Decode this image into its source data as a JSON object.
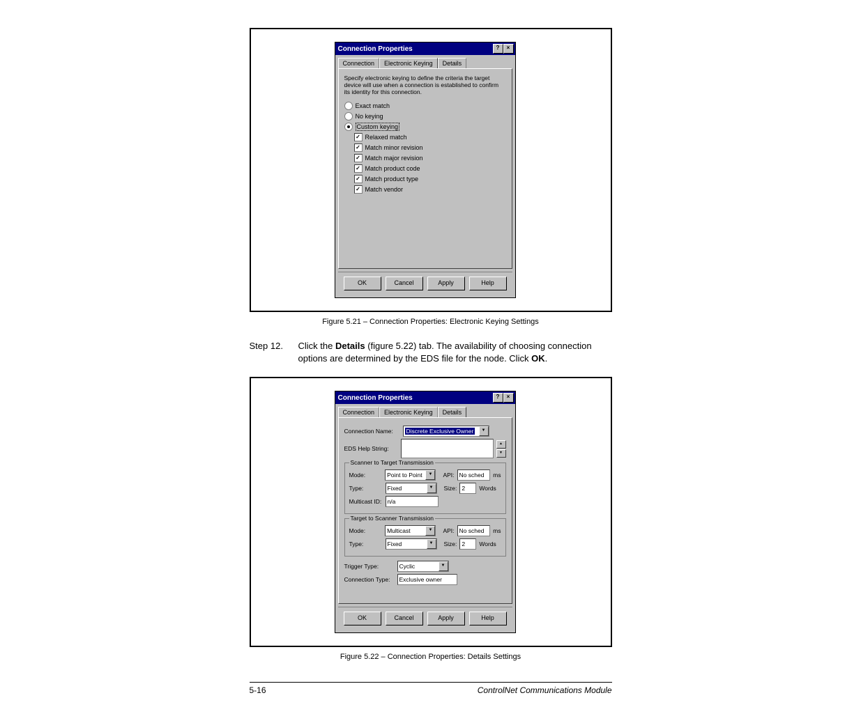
{
  "dialog1": {
    "title": "Connection Properties",
    "tabs": {
      "connection": "Connection",
      "ekeying": "Electronic Keying",
      "details": "Details"
    },
    "instruct": "Specify electronic keying to define the criteria the target device will use when a connection is established to confirm its identity for this connection.",
    "radios": {
      "exact": "Exact match",
      "none": "No keying",
      "custom": "Custom keying"
    },
    "checks": {
      "relaxed": "Relaxed match",
      "minor": "Match minor revision",
      "major": "Match major revision",
      "pcode": "Match product code",
      "ptype": "Match product type",
      "vendor": "Match vendor"
    },
    "buttons": {
      "ok": "OK",
      "cancel": "Cancel",
      "apply": "Apply",
      "help": "Help"
    }
  },
  "caption1": "Figure 5.21 – Connection Properties: Electronic Keying Settings",
  "step": {
    "label": "Step 12.",
    "text_a": "Click the ",
    "bold_a": "Details",
    "text_b": " (figure 5.22) tab. The availability of choosing connection options are determined by the EDS file for the node. Click ",
    "bold_b": "OK",
    "text_c": "."
  },
  "dialog2": {
    "title": "Connection Properties",
    "tabs": {
      "connection": "Connection",
      "ekeying": "Electronic Keying",
      "details": "Details"
    },
    "conn_name_lbl": "Connection Name:",
    "conn_name_val": "Discrete Exclusive Owner",
    "eds_help_lbl": "EDS Help String:",
    "group1": {
      "legend": "Scanner to Target Transmission",
      "mode_lbl": "Mode:",
      "mode_val": "Point to Point",
      "api_lbl": "API:",
      "api_val": "No sched",
      "api_unit": "ms",
      "type_lbl": "Type:",
      "type_val": "Fixed",
      "size_lbl": "Size:",
      "size_val": "2",
      "size_unit": "Words",
      "mcast_lbl": "Multicast ID:",
      "mcast_val": "n/a"
    },
    "group2": {
      "legend": "Target to Scanner Transmission",
      "mode_lbl": "Mode:",
      "mode_val": "Multicast",
      "api_lbl": "API:",
      "api_val": "No sched",
      "api_unit": "ms",
      "type_lbl": "Type:",
      "type_val": "Fixed",
      "size_lbl": "Size:",
      "size_val": "2",
      "size_unit": "Words"
    },
    "trigger_lbl": "Trigger Type:",
    "trigger_val": "Cyclic",
    "conntype_lbl": "Connection Type:",
    "conntype_val": "Exclusive owner",
    "buttons": {
      "ok": "OK",
      "cancel": "Cancel",
      "apply": "Apply",
      "help": "Help"
    }
  },
  "caption2": "Figure 5.22 – Connection Properties: Details Settings",
  "footer": {
    "page": "5-16",
    "title": "ControlNet Communications Module"
  }
}
